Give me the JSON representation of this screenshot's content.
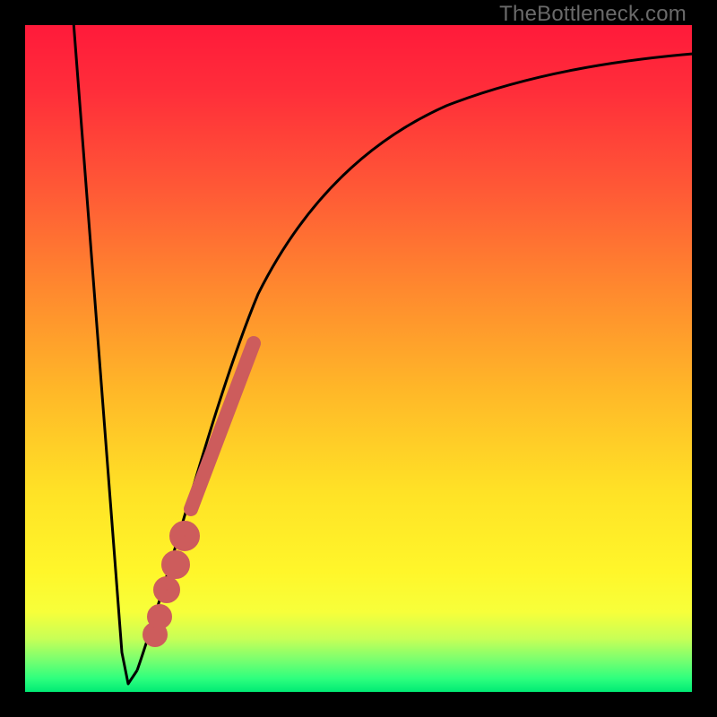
{
  "watermark": {
    "text": "TheBottleneck.com"
  },
  "chart_data": {
    "type": "line",
    "title": "",
    "xlabel": "",
    "ylabel": "",
    "xlim": [
      0,
      100
    ],
    "ylim": [
      0,
      100
    ],
    "series": [
      {
        "name": "bottleneck-curve",
        "x": [
          5,
          10,
          12,
          14,
          16,
          20,
          25,
          30,
          35,
          40,
          50,
          60,
          70,
          80,
          90,
          100
        ],
        "y": [
          100,
          20,
          5,
          1,
          5,
          20,
          40,
          55,
          65,
          72,
          82,
          88,
          92,
          94,
          95.5,
          96.5
        ]
      }
    ],
    "markers": {
      "name": "highlight-segment",
      "color": "#cd5c5c",
      "x": [
        16,
        17,
        18,
        20,
        22,
        24,
        26,
        28,
        30
      ],
      "y": [
        5,
        8,
        11,
        20,
        28,
        35,
        42,
        49,
        55
      ]
    },
    "optimum_x": 14
  }
}
